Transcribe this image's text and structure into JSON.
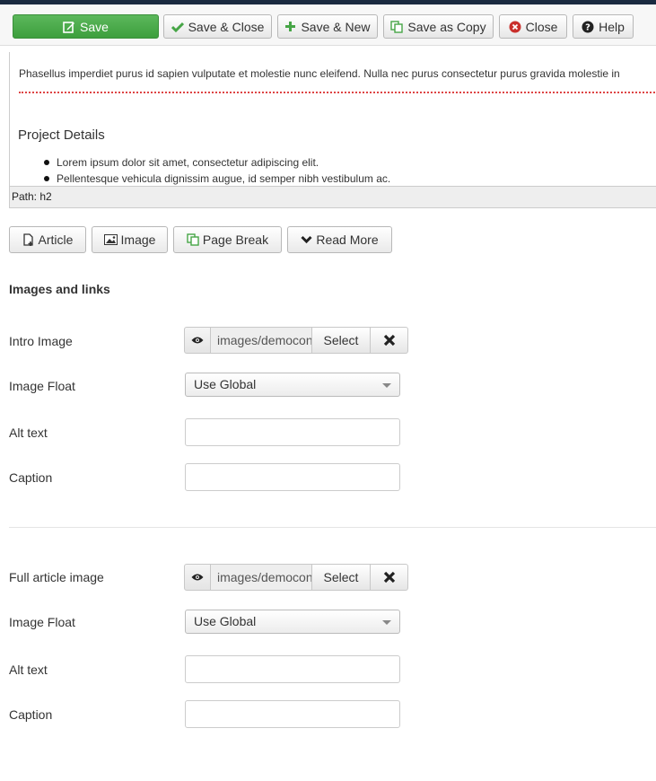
{
  "toolbar": {
    "save": "Save",
    "save_close": "Save & Close",
    "save_new": "Save & New",
    "save_copy": "Save as Copy",
    "close": "Close",
    "help": "Help"
  },
  "editor": {
    "paragraph": "Phasellus imperdiet purus id sapien vulputate et molestie nunc eleifend. Nulla nec purus consectetur purus gravida molestie in",
    "heading": "Project Details",
    "list": [
      "Lorem ipsum dolor sit amet, consectetur adipiscing elit.",
      "Pellentesque vehicula dignissim augue, id semper nibh vestibulum ac."
    ],
    "path": "Path: h2"
  },
  "editor_buttons": {
    "article": "Article",
    "image": "Image",
    "page_break": "Page Break",
    "read_more": "Read More"
  },
  "images_links": {
    "title": "Images and links",
    "intro": {
      "image_label": "Intro Image",
      "image_value": "images/democontent",
      "select": "Select",
      "float_label": "Image Float",
      "float_value": "Use Global",
      "alt_label": "Alt text",
      "alt_value": "",
      "caption_label": "Caption",
      "caption_value": ""
    },
    "full": {
      "image_label": "Full article image",
      "image_value": "images/democontent",
      "select": "Select",
      "float_label": "Image Float",
      "float_value": "Use Global",
      "alt_label": "Alt text",
      "alt_value": "",
      "caption_label": "Caption",
      "caption_value": ""
    }
  },
  "colors": {
    "save_green": "#46a546",
    "close_red": "#c9302c",
    "page_break_line": "#d44444"
  }
}
